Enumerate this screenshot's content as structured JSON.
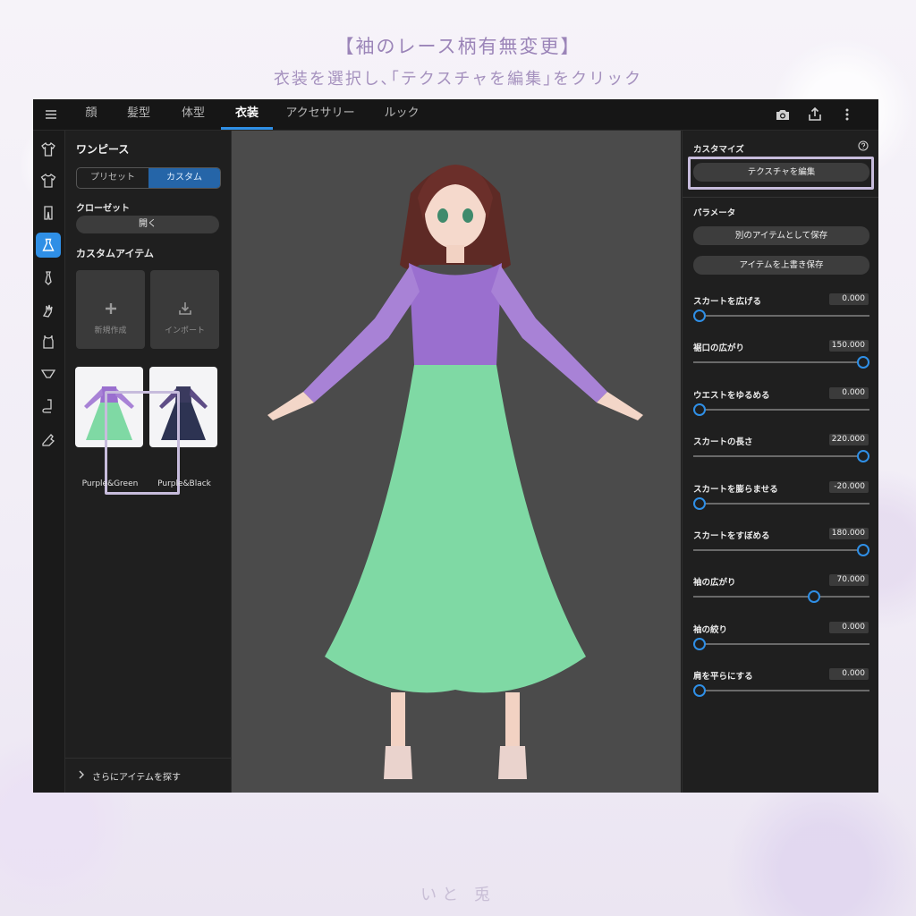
{
  "heading": {
    "line1": "【袖のレース柄有無変更】",
    "line2": "衣装を選択し､｢テクスチャを編集｣をクリック"
  },
  "signature": "いと 兎",
  "topbar": {
    "tabs": [
      "顔",
      "髪型",
      "体型",
      "衣装",
      "アクセサリー",
      "ルック"
    ],
    "active_tab": "衣装"
  },
  "left_panel": {
    "title": "ワンピース",
    "segments": [
      "プリセット",
      "カスタム"
    ],
    "active_segment": "カスタム",
    "closet_label": "クローゼット",
    "closet_button": "開く",
    "custom_items_label": "カスタムアイテム",
    "tiles": [
      "新規作成",
      "インポート"
    ],
    "items": [
      "Purple&Green",
      "Purple&Black"
    ],
    "selected_item": "Purple&Green",
    "more_items": "さらにアイテムを探す"
  },
  "right_panel": {
    "customize_label": "カスタマイズ",
    "edit_texture_button": "テクスチャを編集",
    "parameters_label": "パラメータ",
    "save_as_button": "別のアイテムとして保存",
    "overwrite_button": "アイテムを上書き保存",
    "params": [
      {
        "label": "スカートを広げる",
        "value": "0.000",
        "pos": 0.0
      },
      {
        "label": "裾口の広がり",
        "value": "150.000",
        "pos": 1.0
      },
      {
        "label": "ウエストをゆるめる",
        "value": "0.000",
        "pos": 0.0
      },
      {
        "label": "スカートの長さ",
        "value": "220.000",
        "pos": 1.0
      },
      {
        "label": "スカートを膨らませる",
        "value": "-20.000",
        "pos": 0.0
      },
      {
        "label": "スカートをすぼめる",
        "value": "180.000",
        "pos": 1.0
      },
      {
        "label": "袖の広がり",
        "value": "70.000",
        "pos": 0.7
      },
      {
        "label": "袖の絞り",
        "value": "0.000",
        "pos": 0.0
      },
      {
        "label": "肩を平らにする",
        "value": "0.000",
        "pos": 0.0
      }
    ]
  },
  "colors": {
    "accent": "#2f8fe6",
    "highlight": "#c7bcdc",
    "dress_top": "#9a6fcf",
    "dress_skirt": "#7fd9a4"
  },
  "icons": [
    "menu-icon",
    "camera-icon",
    "share-icon",
    "more-icon",
    "plus-icon",
    "import-icon",
    "help-icon",
    "chevron-right-icon"
  ]
}
